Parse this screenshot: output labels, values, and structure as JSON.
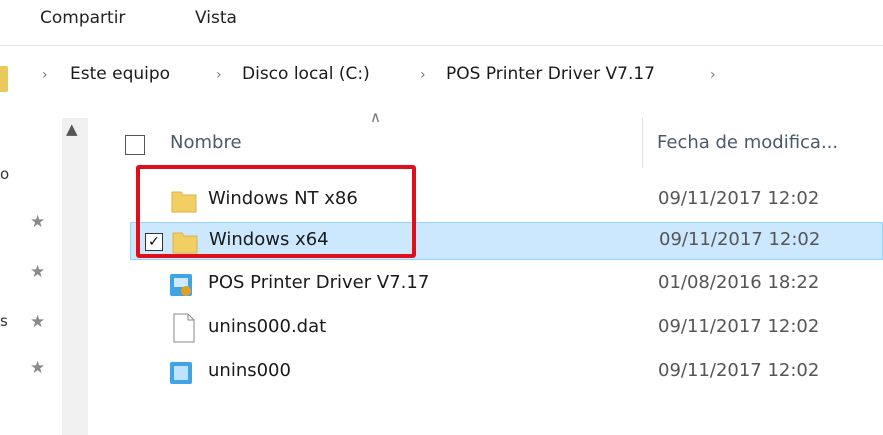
{
  "ribbon": {
    "tabs": [
      "Compartir",
      "Vista"
    ]
  },
  "address_bar": {
    "crumbs": [
      "Este equipo",
      "Disco local (C:)",
      "POS Printer Driver V7.17"
    ]
  },
  "nav_pane": {
    "fragments": [
      "o",
      "s"
    ]
  },
  "list": {
    "columns": {
      "name": "Nombre",
      "date": "Fecha de modifica..."
    },
    "rows": [
      {
        "name": "Windows NT x86",
        "date": "09/11/2017 12:02",
        "icon": "folder-icon",
        "selected": false
      },
      {
        "name": "Windows x64",
        "date": "09/11/2017 12:02",
        "icon": "folder-icon",
        "selected": true
      },
      {
        "name": "POS Printer Driver V7.17",
        "date": "01/08/2016 18:22",
        "icon": "setup-app-icon",
        "selected": false
      },
      {
        "name": "unins000.dat",
        "date": "09/11/2017 12:02",
        "icon": "file-icon",
        "selected": false
      },
      {
        "name": "unins000",
        "date": "09/11/2017 12:02",
        "icon": "uninstaller-app-icon",
        "selected": false
      }
    ]
  },
  "colors": {
    "selection": "#cce8ff",
    "highlight_box": "#e0101a",
    "folder": "#f2cf63"
  }
}
